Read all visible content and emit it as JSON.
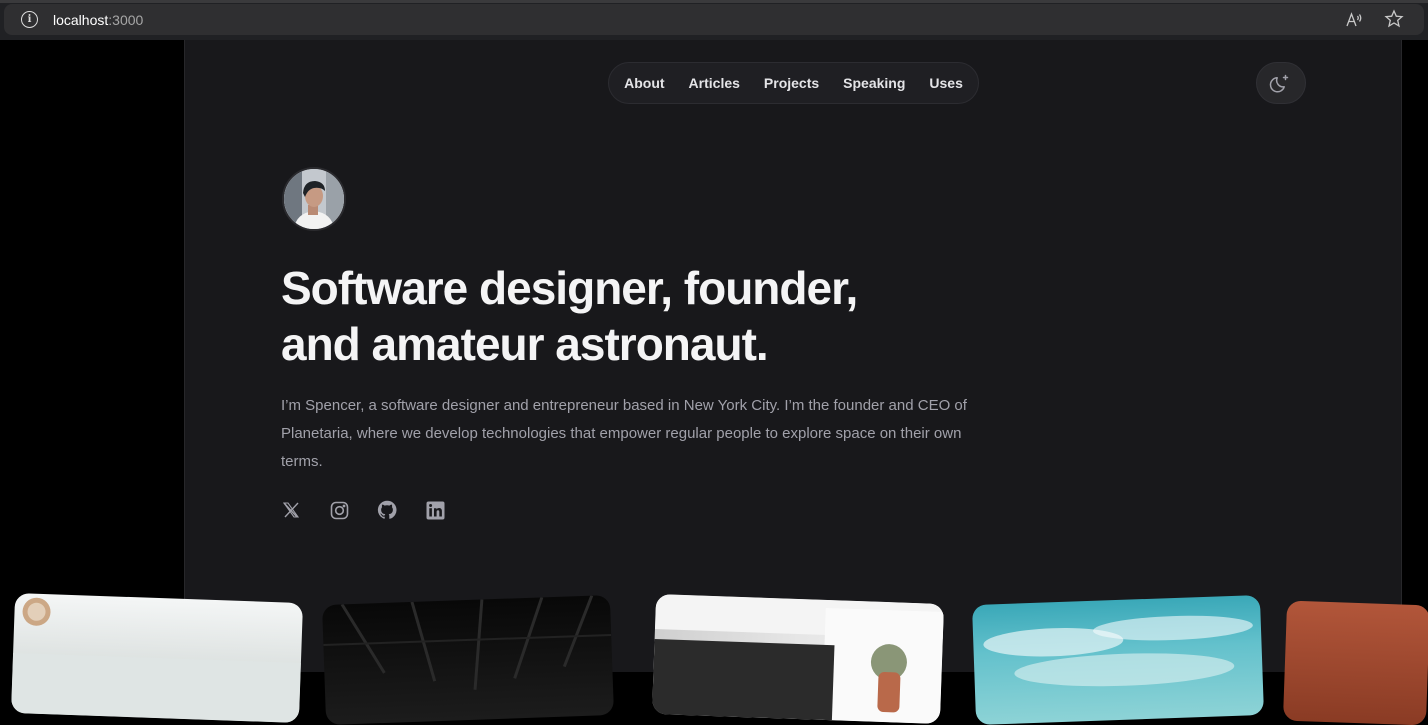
{
  "browser": {
    "url_host": "localhost",
    "url_port": ":3000"
  },
  "nav": {
    "items": [
      {
        "label": "About"
      },
      {
        "label": "Articles"
      },
      {
        "label": "Projects"
      },
      {
        "label": "Speaking"
      },
      {
        "label": "Uses"
      }
    ]
  },
  "hero": {
    "headline_line1": "Software designer, founder,",
    "headline_line2": "and amateur astronaut.",
    "intro": "I’m Spencer, a software designer and entrepreneur based in New York City. I’m the founder and CEO of Planetaria, where we develop technologies that empower regular people to explore space on their own terms."
  },
  "socials": [
    {
      "icon": "x-icon"
    },
    {
      "icon": "instagram-icon"
    },
    {
      "icon": "github-icon"
    },
    {
      "icon": "linkedin-icon"
    }
  ],
  "colors": {
    "page_bg": "#18181b",
    "outer_bg": "#000000",
    "text_primary": "#f4f4f5",
    "text_muted": "#a1a1aa"
  }
}
